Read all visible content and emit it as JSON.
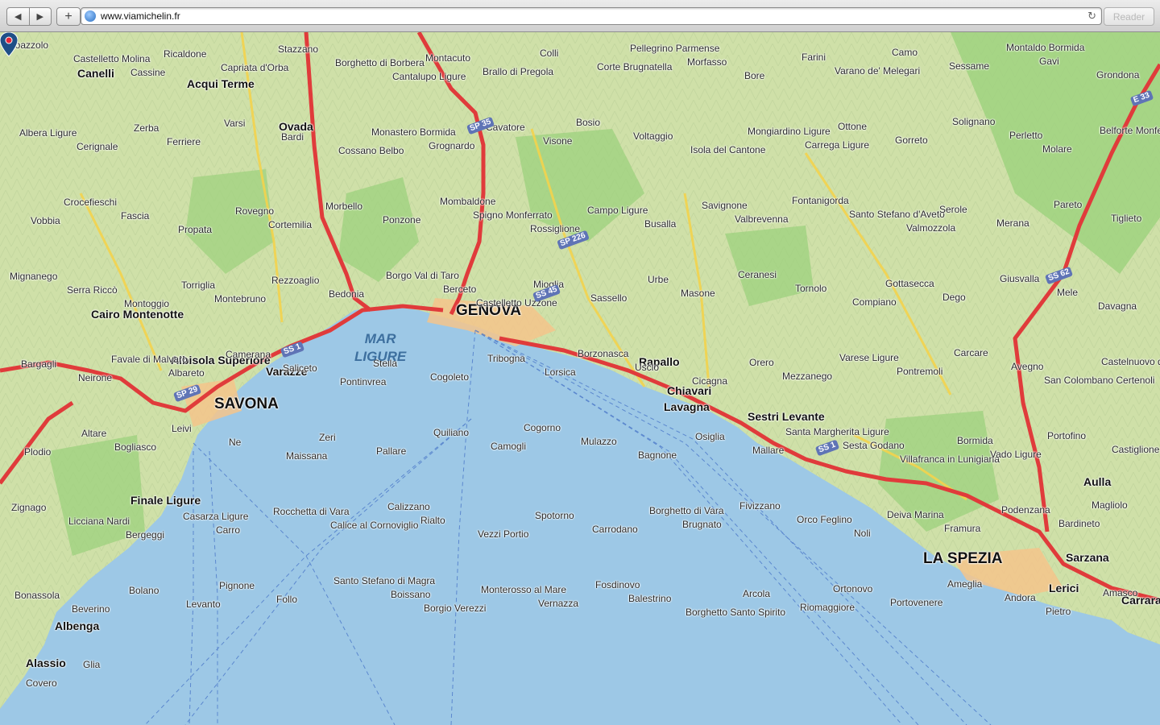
{
  "browser": {
    "url": "www.viamichelin.fr",
    "reader_label": "Reader",
    "back_icon": "back-arrow-icon",
    "forward_icon": "forward-arrow-icon",
    "add_icon": "plus-icon",
    "reload_icon": "reload-icon"
  },
  "map": {
    "colors": {
      "sea": "#9dc8e6",
      "land": "#cfe0a8",
      "park": "#9fd27f",
      "city": "#f5c48b",
      "motorway": "#e03b3b",
      "road": "#f3d34d"
    },
    "sea_label": [
      "MAR",
      "LIGURE"
    ],
    "cities": [
      "GENOVA",
      "SAVONA",
      "LA SPEZIA"
    ],
    "towns": [
      "Chiavari",
      "Lavagna",
      "Rapallo",
      "Sestri Levante",
      "Varazze",
      "Finale Ligure",
      "Albenga",
      "Alassio",
      "Cairo Montenotte",
      "Albisola Superiore",
      "Acqui Terme",
      "Ovada",
      "Canelli",
      "Aulla",
      "Sarzana",
      "Lerici",
      "Carrara"
    ],
    "places": [
      "Coazzolo",
      "Castelletto Molina",
      "Cassine",
      "Ricaldone",
      "Capriata d'Orba",
      "Stazzano",
      "Borghetto di Borbera",
      "Cantalupo Ligure",
      "Montacuto",
      "Brallo di Pregola",
      "Colli",
      "Corte Brugnatella",
      "Pellegrino Parmense",
      "Morfasso",
      "Bore",
      "Farini",
      "Varano de' Melegari",
      "Camo",
      "Sessame",
      "Montaldo Bormida",
      "Gavi",
      "Grondona",
      "Albera Ligure",
      "Cerignale",
      "Zerba",
      "Ferriere",
      "Varsi",
      "Bardi",
      "Cossano Belbo",
      "Monastero Bormida",
      "Grognardo",
      "Cavatore",
      "Visone",
      "Bosio",
      "Voltaggio",
      "Isola del Cantone",
      "Mongiardino Ligure",
      "Carrega Ligure",
      "Ottone",
      "Gorreto",
      "Solignano",
      "Perletto",
      "Molare",
      "Belforte Monferrato",
      "Vobbia",
      "Crocefieschi",
      "Fascia",
      "Propata",
      "Rovegno",
      "Cortemilia",
      "Morbello",
      "Ponzone",
      "Mombaldone",
      "Spigno Monferrato",
      "Rossiglione",
      "Campo Ligure",
      "Busalla",
      "Savignone",
      "Valbrevenna",
      "Fontanigorda",
      "Santo Stefano d'Aveto",
      "Valmozzola",
      "Serole",
      "Merana",
      "Pareto",
      "Tiglieto",
      "Mignanego",
      "Serra Riccò",
      "Montoggio",
      "Torriglia",
      "Montebruno",
      "Rezzoaglio",
      "Bedonia",
      "Borgo Val di Taro",
      "Berceto",
      "Castelletto Uzzone",
      "Mioglia",
      "Sassello",
      "Urbe",
      "Masone",
      "Ceranesi",
      "Tornolo",
      "Compiano",
      "Gottasecca",
      "Dego",
      "Giusvalla",
      "Mele",
      "Davagna",
      "Bargagli",
      "Neirone",
      "Favale di Malvaro",
      "Albareto",
      "Camerana",
      "Saliceto",
      "Pontinvrea",
      "Stella",
      "Cogoleto",
      "Tribogna",
      "Lorsica",
      "Borzonasca",
      "Uscio",
      "Cicagna",
      "Orero",
      "Mezzanego",
      "Varese Ligure",
      "Pontremoli",
      "Carcare",
      "Avegno",
      "San Colombano Certenoli",
      "Castelnuovo di Ceva",
      "Plodio",
      "Altare",
      "Bogliasco",
      "Leivi",
      "Ne",
      "Maissana",
      "Zeri",
      "Pallare",
      "Quiliano",
      "Camogli",
      "Cogorno",
      "Mulazzo",
      "Bagnone",
      "Osiglia",
      "Mallare",
      "Santa Margherita Ligure",
      "Sesta Godano",
      "Villafranca in Lunigiana",
      "Bormida",
      "Vado Ligure",
      "Portofino",
      "Castiglione Chiavarese",
      "Zignago",
      "Licciana Nardi",
      "Bergeggi",
      "Casarza Ligure",
      "Carro",
      "Rocchetta di Vara",
      "Calice al Cornoviglio",
      "Calizzano",
      "Rialto",
      "Vezzi Portio",
      "Spotorno",
      "Carrodano",
      "Borghetto di Vara",
      "Brugnato",
      "Fivizzano",
      "Orco Feglino",
      "Noli",
      "Deiva Marina",
      "Framura",
      "Podenzana",
      "Bardineto",
      "Magliolo",
      "Bonassola",
      "Beverino",
      "Bolano",
      "Levanto",
      "Pignone",
      "Follo",
      "Santo Stefano di Magra",
      "Boissano",
      "Borgio Verezzi",
      "Monterosso al Mare",
      "Vernazza",
      "Fosdinovo",
      "Balestrino",
      "Borghetto Santo Spirito",
      "Arcola",
      "Riomaggiore",
      "Ortonovo",
      "Portovenere",
      "Ameglia",
      "Andora",
      "Pietro",
      "Amasco",
      "Covero",
      "Glia"
    ],
    "road_shields": [
      "SP 35",
      "SP 226",
      "SS 45",
      "SS 1",
      "SP 29",
      "SS 1",
      "SS 62",
      "E 33"
    ]
  }
}
